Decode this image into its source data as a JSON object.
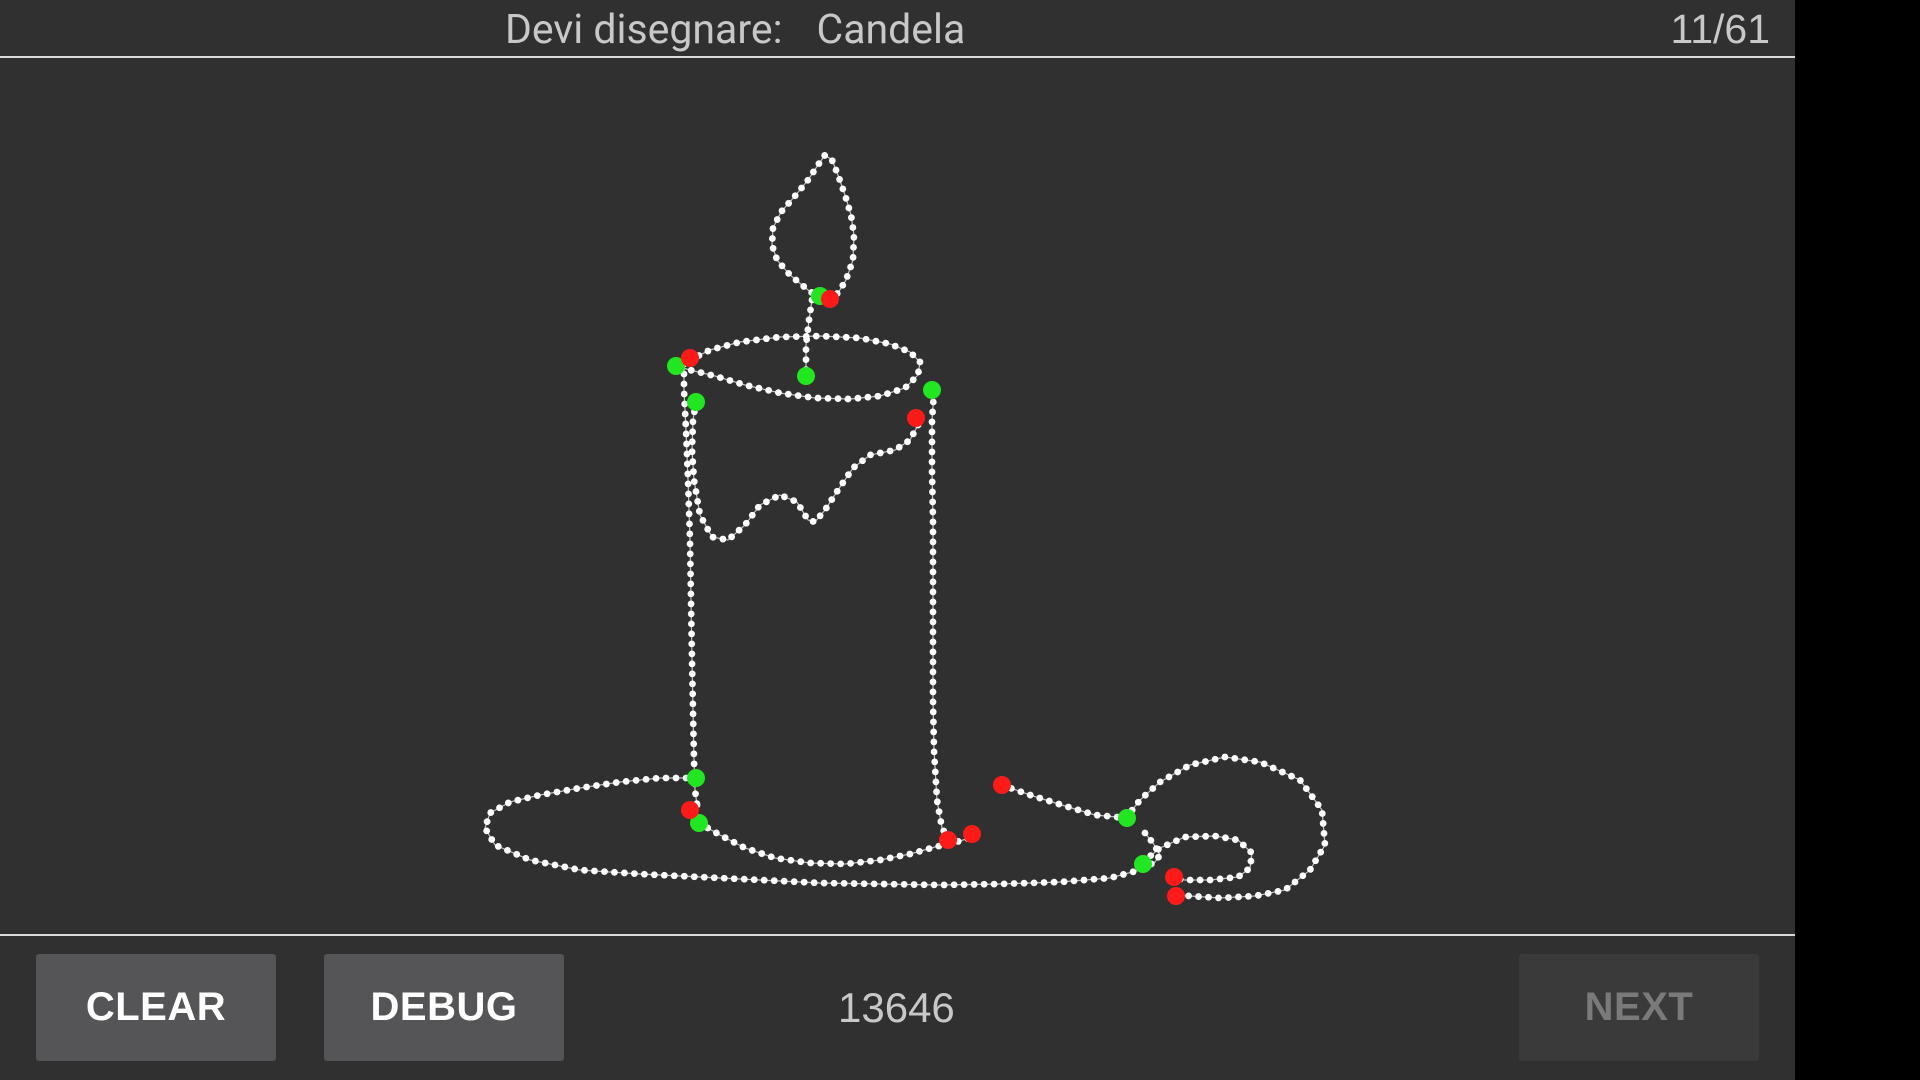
{
  "header": {
    "prompt_label": "Devi disegnare:",
    "word": "Candela",
    "progress": "11/61"
  },
  "footer": {
    "clear_label": "CLEAR",
    "debug_label": "DEBUG",
    "score": "13646",
    "next_label": "NEXT"
  },
  "colors": {
    "background": "#303030",
    "stroke_points": "#ffffff",
    "stroke_start": "#22e622",
    "stroke_end": "#ff1a1a",
    "button": "#555557",
    "button_disabled": "#3a3a3b"
  },
  "drawing": {
    "subject": "candle",
    "point_color_legend": [
      "start-point",
      "end-point"
    ]
  }
}
